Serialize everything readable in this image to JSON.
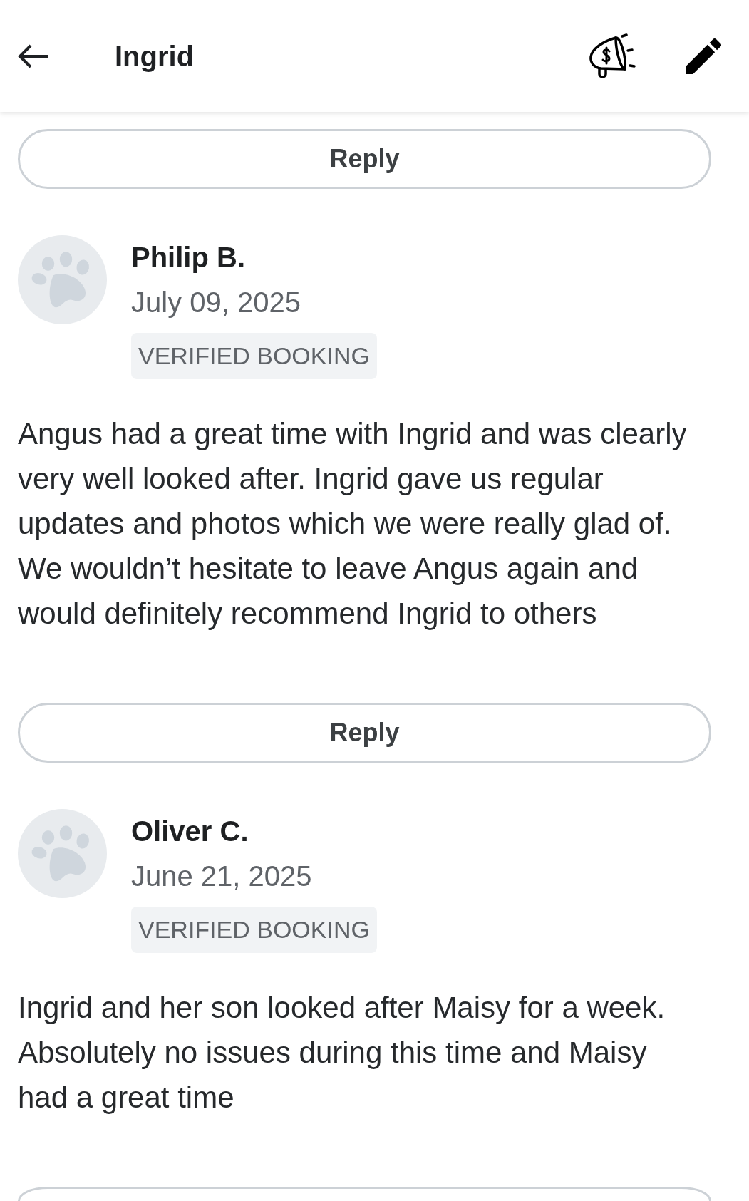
{
  "header": {
    "title": "Ingrid"
  },
  "feed": [
    {
      "kind": "reply",
      "label": "Reply"
    },
    {
      "kind": "review",
      "author": "Philip B.",
      "date": "July 09, 2025",
      "badge": "VERIFIED BOOKING",
      "text": "Angus had a great time with Ingrid and was clearly very well looked after. Ingrid gave us regular updates and photos which we were really glad of. We wouldn’t hesitate to leave Angus again and would definitely recommend Ingrid to others"
    },
    {
      "kind": "reply",
      "label": "Reply"
    },
    {
      "kind": "review",
      "author": "Oliver C.",
      "date": "June 21, 2025",
      "badge": "VERIFIED BOOKING",
      "text": "Ingrid and her son looked after Maisy for a week. Absolutely no issues during this time and Maisy had a great time"
    },
    {
      "kind": "reply_partial"
    }
  ]
}
